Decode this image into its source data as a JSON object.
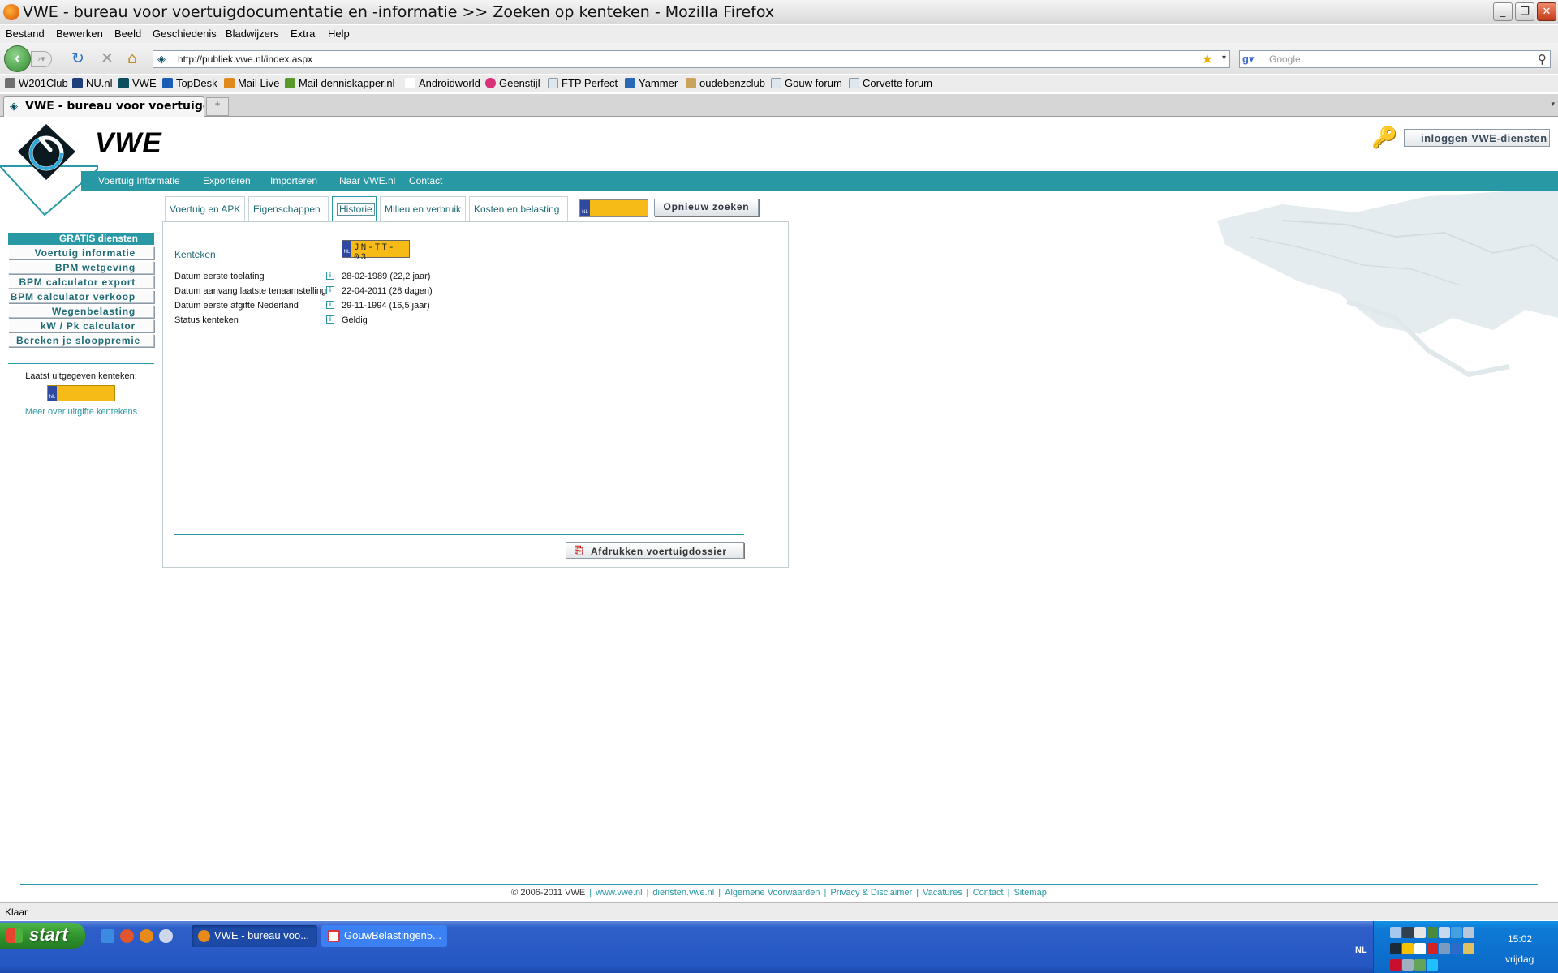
{
  "window": {
    "title": "VWE - bureau voor voertuigdocumentatie en -informatie >> Zoeken op kenteken - Mozilla Firefox",
    "buttons": [
      "_",
      "❐",
      "✕"
    ]
  },
  "menubar": [
    "Bestand",
    "Bewerken",
    "Beeld",
    "Geschiedenis",
    "Bladwijzers",
    "Extra",
    "Help"
  ],
  "navigation": {
    "url": "http://publiek.vwe.nl/index.aspx",
    "search_placeholder": "Google"
  },
  "bookmarks": [
    {
      "label": "W201Club",
      "color": "#6f6f6f"
    },
    {
      "label": "NU.nl",
      "color": "#1d3f7a"
    },
    {
      "label": "VWE",
      "color": "#0a4e5f"
    },
    {
      "label": "TopDesk",
      "color": "#1c5cb5"
    },
    {
      "label": "Mail Live",
      "color": "#e08a1d"
    },
    {
      "label": "Mail denniskapper.nl",
      "color": "#5a9a2c"
    },
    {
      "label": "Androidworld",
      "color": "#ffffff"
    },
    {
      "label": "Geenstijl",
      "color": "#d8317a"
    },
    {
      "label": "FTP Perfect",
      "color": "#dfe7ee"
    },
    {
      "label": "Yammer",
      "color": "#2a68b4"
    },
    {
      "label": "oudebenzclub",
      "color": "#c9a35a"
    },
    {
      "label": "Gouw forum",
      "color": "#dfe7ee"
    },
    {
      "label": "Corvette forum",
      "color": "#dfe7ee"
    }
  ],
  "tab": {
    "label": "VWE - bureau voor voertuigdoc..."
  },
  "site": {
    "brand": "VWE",
    "login_button": "inloggen VWE-diensten",
    "nav": [
      "Voertuig Informatie",
      "Exporteren",
      "Importeren",
      "Naar VWE.nl",
      "Contact"
    ],
    "sidebar": {
      "header": "GRATIS diensten",
      "items": [
        "Voertuig informatie",
        "BPM wetgeving",
        "BPM calculator export",
        "BPM calculator verkoop",
        "Wegenbelasting",
        "kW / Pk calculator",
        "Bereken je sloop­premie"
      ]
    },
    "latest": {
      "label": "Laatst uitgegeven kenteken:",
      "more_link": "Meer over uitgifte kentekens"
    },
    "tabs": [
      "Voertuig en APK",
      "Eigenschappen",
      "Historie",
      "Milieu en verbruik",
      "Kosten en belasting"
    ],
    "active_tab": "Historie",
    "search_again": "Opnieuw zoeken",
    "plate_eu": "NL",
    "panel": {
      "title": "Kenteken",
      "plate": "JN-TT-03",
      "rows": [
        {
          "label": "Datum eerste toelating",
          "value": "28-02-1989  (22,2 jaar)"
        },
        {
          "label": "Datum aanvang laatste tenaamstelling",
          "value": "22-04-2011  (28 dagen)"
        },
        {
          "label": "Datum eerste afgifte Nederland",
          "value": "29-11-1994  (16,5 jaar)"
        },
        {
          "label": "Status kenteken",
          "value": "Geldig"
        }
      ],
      "print_button": "Afdrukken voertuigdossier"
    },
    "footer": {
      "copyright": "© 2006-2011 VWE",
      "links": [
        "www.vwe.nl",
        "diensten.vwe.nl",
        "Algemene Voorwaarden",
        "Privacy & Disclaimer",
        "Vacatures",
        "Contact",
        "Sitemap"
      ]
    }
  },
  "statusbar": "Klaar",
  "taskbar": {
    "start": "start",
    "buttons": [
      "VWE - bureau voo...",
      "GouwBelastingen5..."
    ],
    "lang": "NL",
    "time": "15:02",
    "day": "vrijdag"
  }
}
